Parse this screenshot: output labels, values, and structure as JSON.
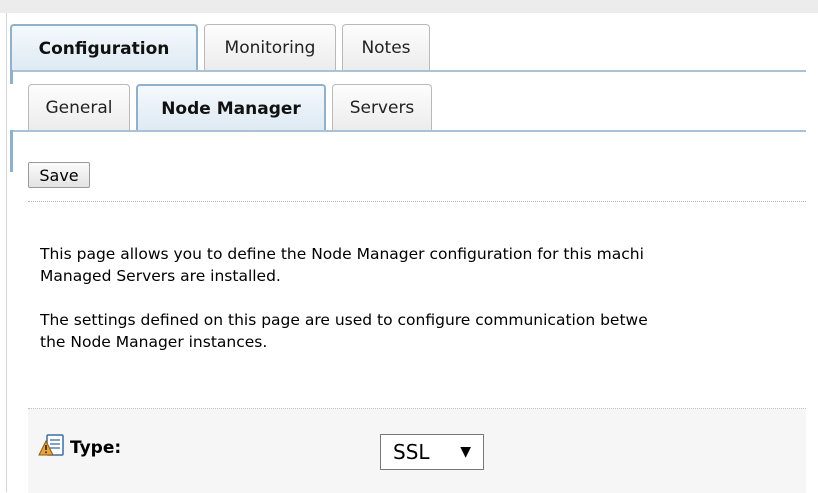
{
  "primary_tabs": [
    {
      "label": "Configuration",
      "active": true
    },
    {
      "label": "Monitoring",
      "active": false
    },
    {
      "label": "Notes",
      "active": false
    }
  ],
  "secondary_tabs": [
    {
      "label": "General",
      "active": false
    },
    {
      "label": "Node Manager",
      "active": true
    },
    {
      "label": "Servers",
      "active": false
    }
  ],
  "toolbar": {
    "save_label": "Save"
  },
  "description": {
    "p1_line1": "This page allows you to define the Node Manager configuration for this machi",
    "p1_line2": "Managed Servers are installed.",
    "p2_line1": "The settings defined on this page are used to configure communication betwe",
    "p2_line2": "the Node Manager instances."
  },
  "settings": {
    "type_label": "Type:",
    "type_icon": "info-warning-icon",
    "type_value": "SSL",
    "arrow": "▼"
  },
  "colors": {
    "active_tab_border": "#8fb1cc",
    "active_tab_bg": "#dde9f3",
    "icon_orange": "#e8a33b"
  }
}
